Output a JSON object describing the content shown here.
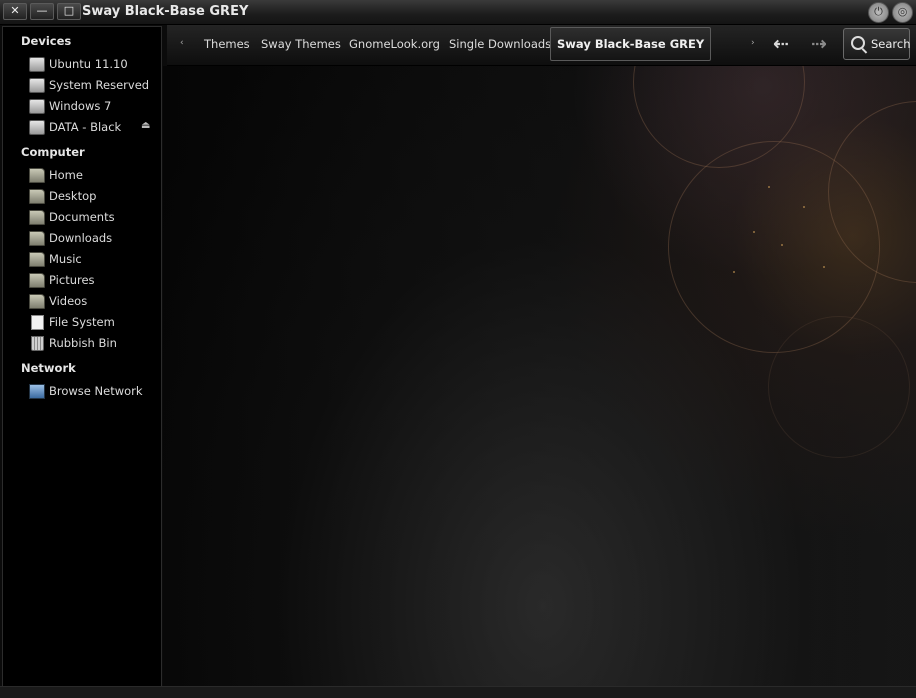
{
  "window": {
    "title": "Sway Black-Base GREY",
    "close_glyph": "✕",
    "minimize_glyph": "—",
    "maximize_glyph": "□"
  },
  "sidebar": {
    "sections": [
      {
        "heading": "Devices",
        "items": [
          {
            "label": "Ubuntu 11.10",
            "icon": "drive-icon"
          },
          {
            "label": "System Reserved",
            "icon": "drive-icon"
          },
          {
            "label": "Windows 7",
            "icon": "drive-icon"
          },
          {
            "label": "DATA - Black",
            "icon": "drive-icon",
            "eject": true
          }
        ]
      },
      {
        "heading": "Computer",
        "items": [
          {
            "label": "Home",
            "icon": "home-folder-icon"
          },
          {
            "label": "Desktop",
            "icon": "desktop-folder-icon"
          },
          {
            "label": "Documents",
            "icon": "documents-folder-icon"
          },
          {
            "label": "Downloads",
            "icon": "downloads-folder-icon"
          },
          {
            "label": "Music",
            "icon": "music-folder-icon"
          },
          {
            "label": "Pictures",
            "icon": "pictures-folder-icon"
          },
          {
            "label": "Videos",
            "icon": "videos-folder-icon"
          },
          {
            "label": "File System",
            "icon": "file-system-icon"
          },
          {
            "label": "Rubbish Bin",
            "icon": "rubbish-bin-icon"
          }
        ]
      },
      {
        "heading": "Network",
        "items": [
          {
            "label": "Browse Network",
            "icon": "network-icon"
          }
        ]
      }
    ],
    "eject_glyph": "⏏"
  },
  "toolbar": {
    "scroll_left": "‹",
    "scroll_right": "›",
    "breadcrumbs": [
      "Themes",
      "Sway Themes",
      "GnomeLook.org",
      "Single Downloads",
      "Sway Black-Base GREY"
    ],
    "active_crumb": "Sway Black-Base GREY",
    "back_glyph": "⇠",
    "forward_glyph": "⇢",
    "search_label": "Search"
  }
}
